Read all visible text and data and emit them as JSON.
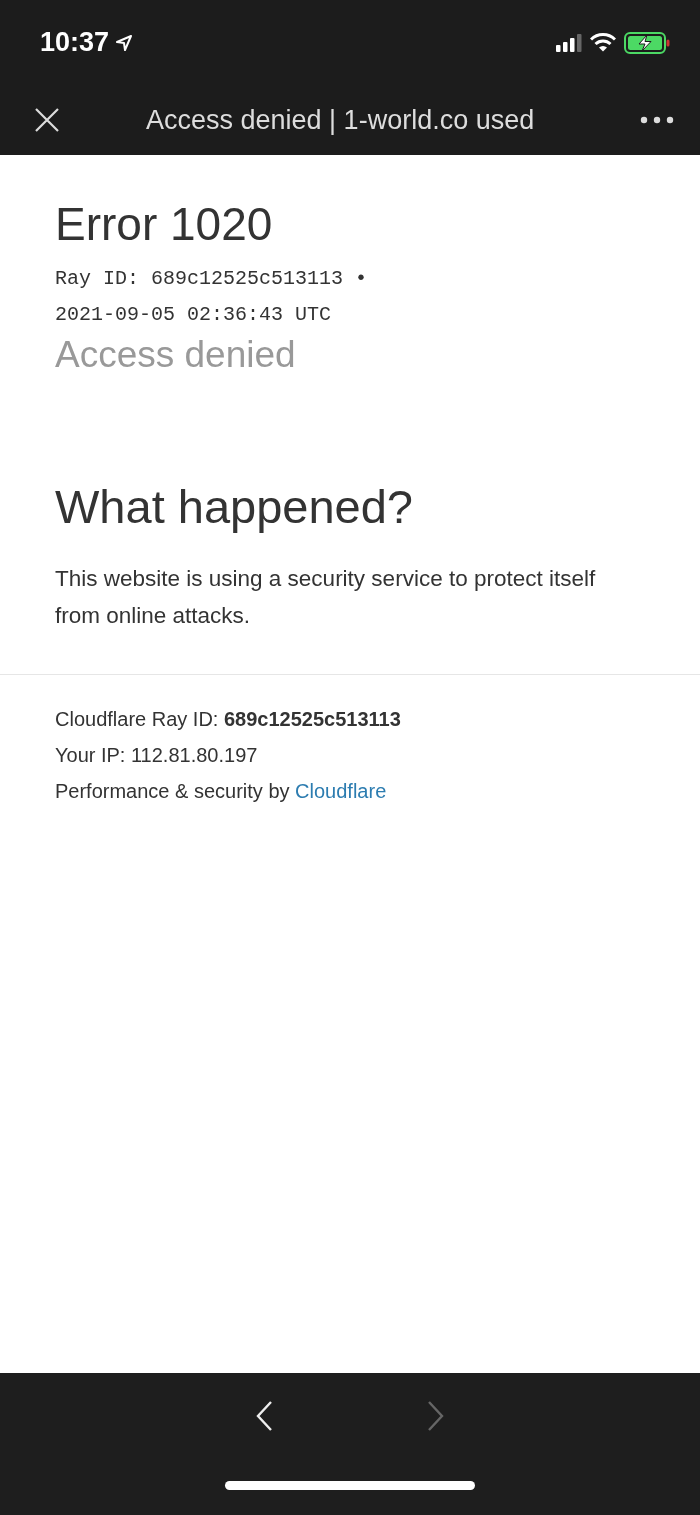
{
  "status_bar": {
    "time": "10:37"
  },
  "browser_bar": {
    "title": "Access denied | 1-world.co used"
  },
  "error": {
    "title": "Error 1020",
    "ray_line": "Ray ID: 689c12525c513113 •",
    "timestamp": "2021-09-05 02:36:43 UTC",
    "subtitle": "Access denied"
  },
  "what_happened": {
    "heading": "What happened?",
    "text": "This website is using a security service to protect itself from online attacks."
  },
  "footer": {
    "ray_label": "Cloudflare Ray ID:",
    "ray_id": "689c12525c513113",
    "ip": "Your IP: 112.81.80.197",
    "performance": "Performance & security by",
    "link": "Cloudflare"
  },
  "toolbar": {
    "back_disabled": false,
    "forward_disabled": true
  }
}
